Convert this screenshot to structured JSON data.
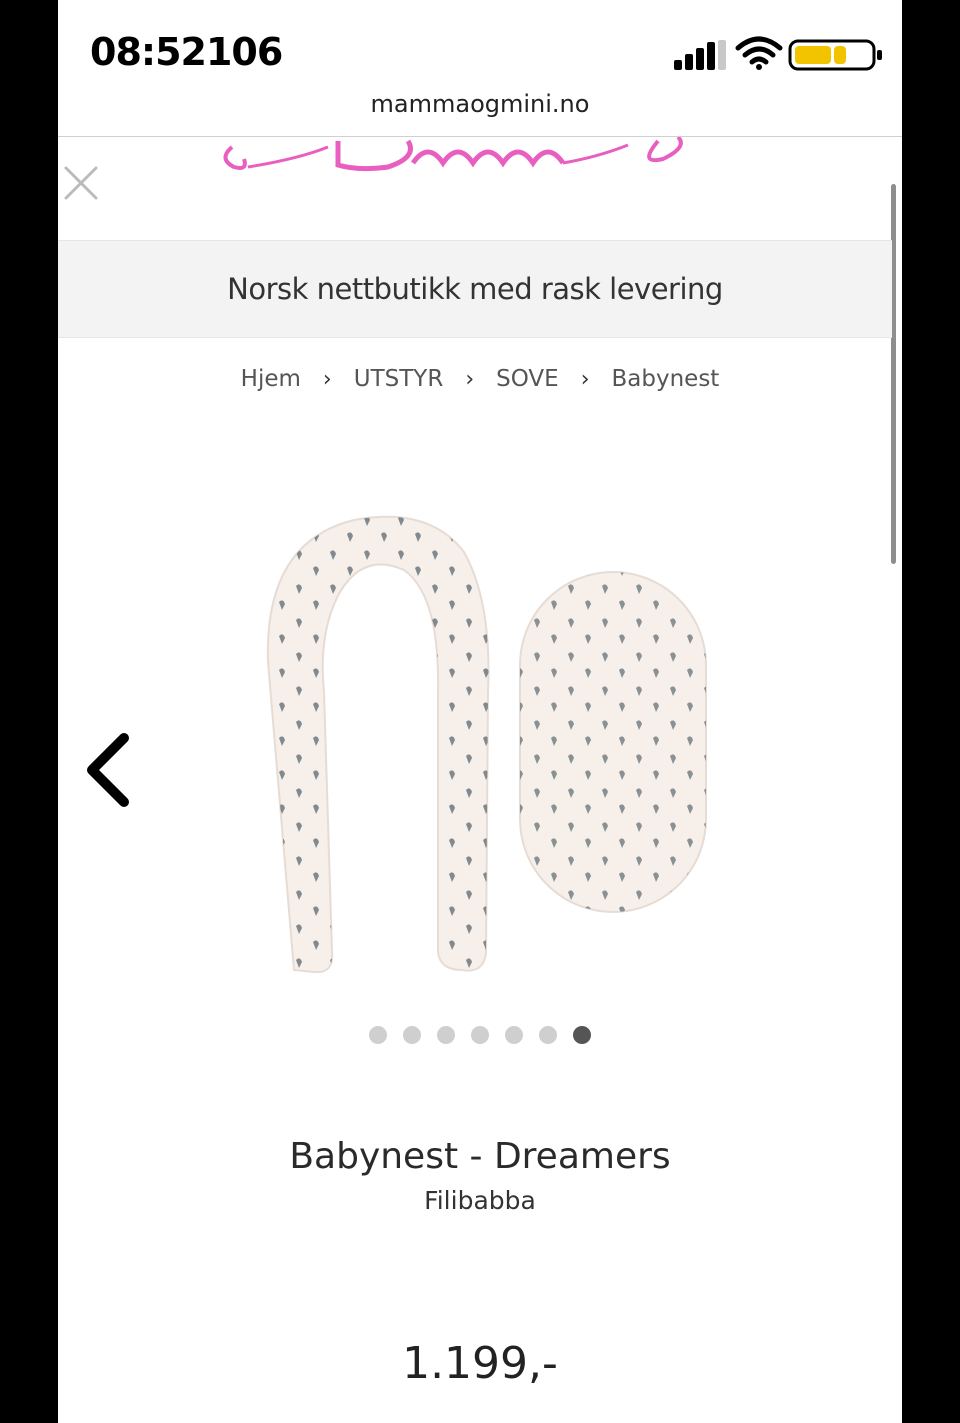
{
  "status_bar": {
    "time": "08:5ᵗ21⁰⁶",
    "time_display": "08:Ƚ2Ɩ0Ƅ"
  },
  "browser": {
    "url": "mammaogmini.no"
  },
  "banner": {
    "text": "Norsk nettbutikk med rask levering"
  },
  "breadcrumb": {
    "items": [
      "Hjem",
      "UTSTYR",
      "SOVE",
      "Babynest"
    ],
    "separator": "›"
  },
  "carousel": {
    "total_slides": 7,
    "active_index": 6
  },
  "product": {
    "title": "Babynest - Dreamers",
    "brand": "Filibabba",
    "price": "1.199,-"
  },
  "colors": {
    "logo_pink": "#e85fc0",
    "fabric": "#f6efea",
    "dot_inactive": "#cfcfcf",
    "dot_active": "#555555"
  }
}
